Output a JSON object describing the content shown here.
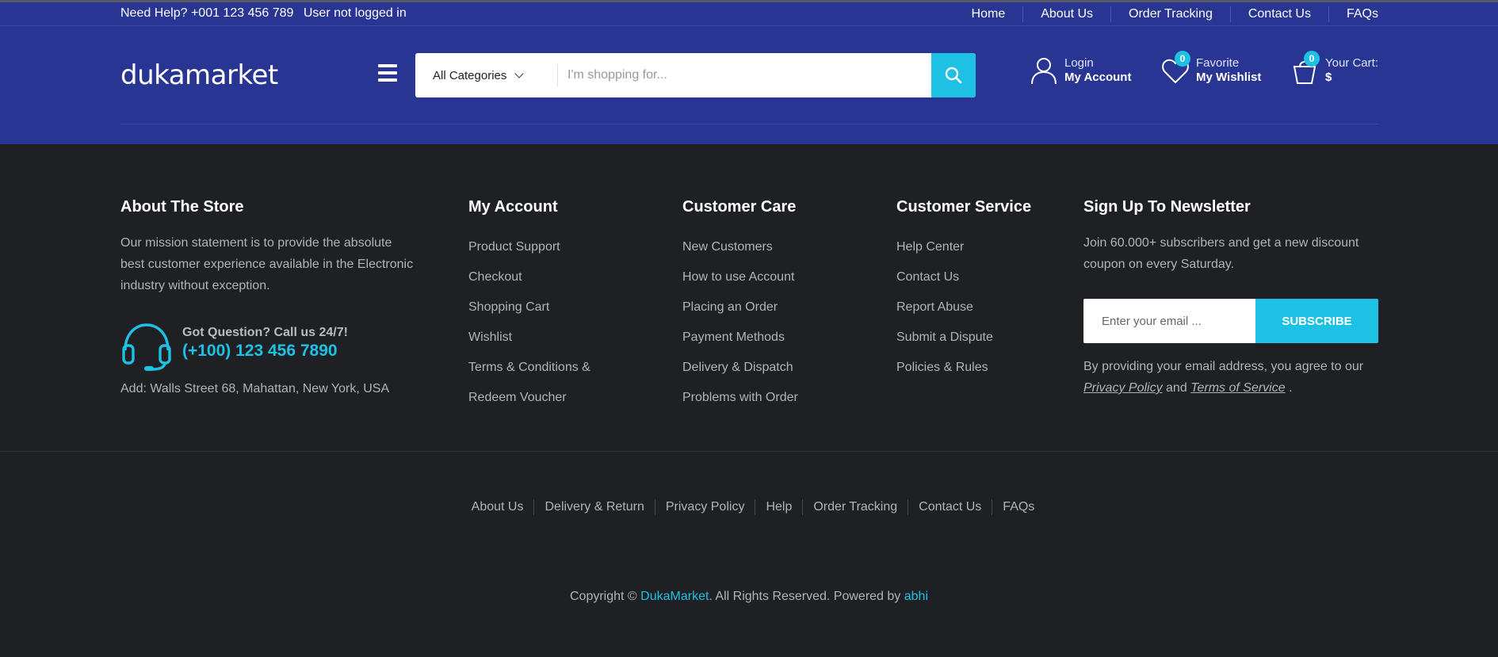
{
  "topbar": {
    "help_text": "Need Help? +001 123 456 789",
    "login_status": "User not logged in",
    "nav": [
      "Home",
      "About Us",
      "Order Tracking",
      "Contact Us",
      "FAQs"
    ]
  },
  "header": {
    "logo": "dukamarket",
    "category_select": "All Categories",
    "search_placeholder": "I'm shopping for...",
    "account": {
      "line1": "Login",
      "line2": "My Account"
    },
    "wishlist": {
      "count": "0",
      "line1": "Favorite",
      "line2": "My Wishlist"
    },
    "cart": {
      "count": "0",
      "line1": "Your Cart:",
      "line2": "$"
    }
  },
  "footer": {
    "about": {
      "title": "About The Store",
      "text": "Our mission statement is to provide the absolute best customer experience available in the Electronic industry without exception.",
      "question": "Got Question? Call us 24/7!",
      "phone": "(+100) 123 456 7890",
      "address": "Add: Walls Street 68, Mahattan, New York, USA"
    },
    "my_account": {
      "title": "My Account",
      "items": [
        "Product Support",
        "Checkout",
        "Shopping Cart",
        "Wishlist",
        "Terms & Conditions &",
        "Redeem Voucher"
      ]
    },
    "customer_care": {
      "title": "Customer Care",
      "items": [
        "New Customers",
        "How to use Account",
        "Placing an Order",
        "Payment Methods",
        "Delivery & Dispatch",
        "Problems with Order"
      ]
    },
    "customer_service": {
      "title": "Customer Service",
      "items": [
        "Help Center",
        "Contact Us",
        "Report Abuse",
        "Submit a Dispute",
        "Policies & Rules"
      ]
    },
    "newsletter": {
      "title": "Sign Up To Newsletter",
      "text": "Join 60.000+ subscribers and get a new discount coupon on every Saturday.",
      "email_placeholder": "Enter your email ...",
      "button": "SUBSCRIBE",
      "consent_prefix": "By providing your email address, you agree to our",
      "privacy_link": "Privacy Policy",
      "and": "and",
      "terms_link": "Terms of Service",
      "period": "."
    },
    "bottom_links": [
      "About Us",
      "Delivery & Return",
      "Privacy Policy",
      "Help",
      "Order Tracking",
      "Contact Us",
      "FAQs"
    ],
    "copyright": {
      "prefix": "Copyright ©",
      "brand": "DukaMarket",
      "middle": ". All Rights Reserved. Powered by",
      "author": "abhi"
    }
  },
  "colors": {
    "header_bg": "#283592",
    "accent": "#1ec0e4",
    "footer_bg": "#1f2024"
  }
}
